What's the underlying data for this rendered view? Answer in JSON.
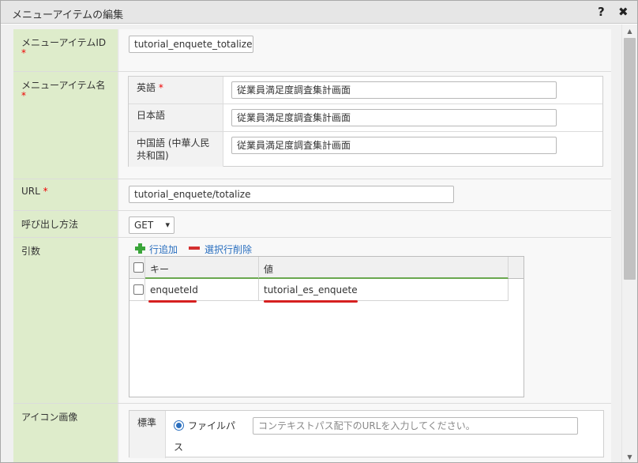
{
  "dialog": {
    "title": "メニューアイテムの編集",
    "help_label": "?",
    "close_label": "✖"
  },
  "required_mark": "*",
  "fields": {
    "item_id": {
      "label": "メニューアイテムID",
      "value": "tutorial_enquete_totalize"
    },
    "item_name": {
      "label": "メニューアイテム名",
      "languages": [
        {
          "label": "英語",
          "required": true,
          "value": "従業員満足度調査集計画面"
        },
        {
          "label": "日本語",
          "required": false,
          "value": "従業員満足度調査集計画面"
        },
        {
          "label": "中国語 (中華人民共和国)",
          "label_line1": "中国語 (中華人民",
          "label_line2": "共和国)",
          "required": false,
          "value": "従業員満足度調査集計画面"
        }
      ]
    },
    "url": {
      "label": "URL",
      "value": "tutorial_enquete/totalize"
    },
    "method": {
      "label": "呼び出し方法",
      "value": "GET",
      "chevron": "chevron-down-icon"
    },
    "args": {
      "label": "引数",
      "add_row": "行追加",
      "delete_rows": "選択行削除",
      "columns": [
        "キー",
        "値"
      ],
      "rows": [
        {
          "key": "enqueteId",
          "value": "tutorial_es_enquete"
        }
      ],
      "highlight_color": "#d62020"
    },
    "icon_image": {
      "label": "アイコン画像",
      "sub_label": "標準",
      "option_line1": "ファイルパ",
      "option_line2": "ス",
      "placeholder": "コンテキストパス配下のURLを入力してください。"
    }
  },
  "colors": {
    "label_bg": "#deeccb",
    "accent_blue": "#2a6fbf",
    "add_green": "#3aa53a",
    "delete_red": "#d43030"
  }
}
